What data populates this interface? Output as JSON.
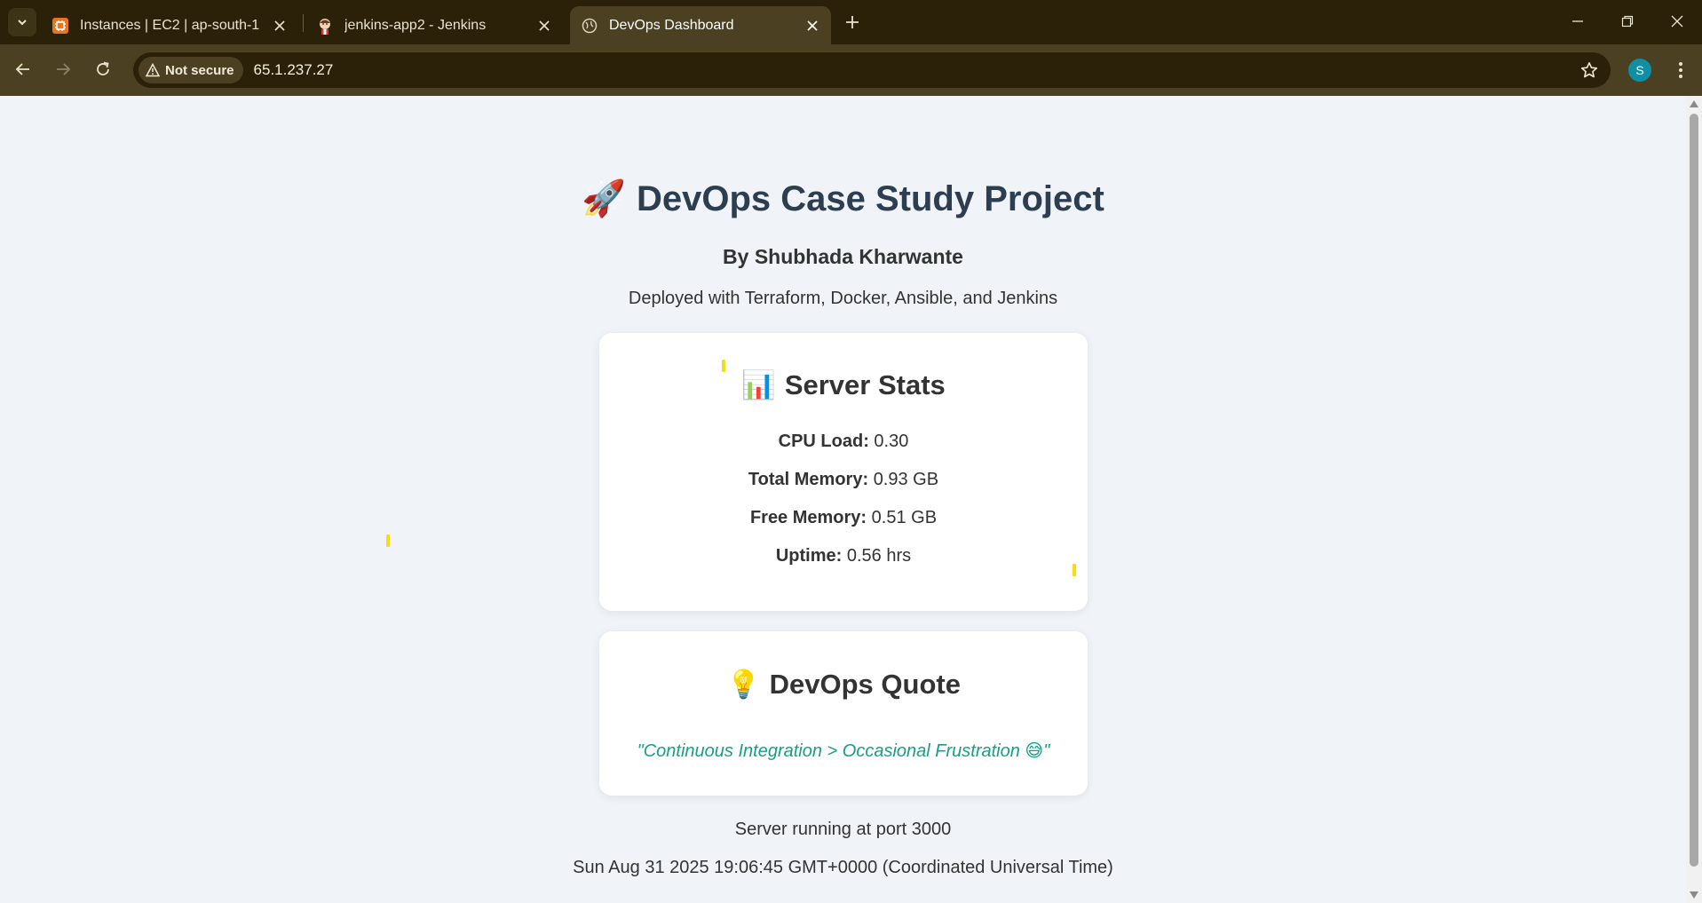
{
  "browser": {
    "tabs": [
      {
        "label": "Instances | EC2 | ap-south-1",
        "icon": "aws-ec2-icon"
      },
      {
        "label": "jenkins-app2 - Jenkins",
        "icon": "jenkins-icon"
      },
      {
        "label": "DevOps Dashboard",
        "icon": "globe-icon",
        "active": true
      }
    ],
    "security_chip": "Not secure",
    "url": "65.1.237.27",
    "profile_initial": "S"
  },
  "page": {
    "title_emoji": "🚀",
    "title": "DevOps Case Study Project",
    "author": "By Shubhada Kharwante",
    "subtitle": "Deployed with Terraform, Docker, Ansible, and Jenkins",
    "stats": {
      "emoji": "📊",
      "title": "Server Stats",
      "rows": [
        {
          "label": "CPU Load:",
          "value": "0.30"
        },
        {
          "label": "Total Memory:",
          "value": "0.93 GB"
        },
        {
          "label": "Free Memory:",
          "value": "0.51 GB"
        },
        {
          "label": "Uptime:",
          "value": "0.56 hrs"
        }
      ]
    },
    "quote": {
      "emoji": "💡",
      "title": "DevOps Quote",
      "text": "\"Continuous Integration > Occasional Frustration 😅\""
    },
    "footer": {
      "port_line": "Server running at port 3000",
      "datetime": "Sun Aug 31 2025 19:06:45 GMT+0000 (Coordinated Universal Time)"
    }
  },
  "colors": {
    "title": "#2c3e50",
    "quote": "#16a085",
    "background": "#f0f3f8",
    "chrome_dark": "#2a2108",
    "chrome_toolbar": "#4b4021",
    "spark": "#f7dc11"
  }
}
